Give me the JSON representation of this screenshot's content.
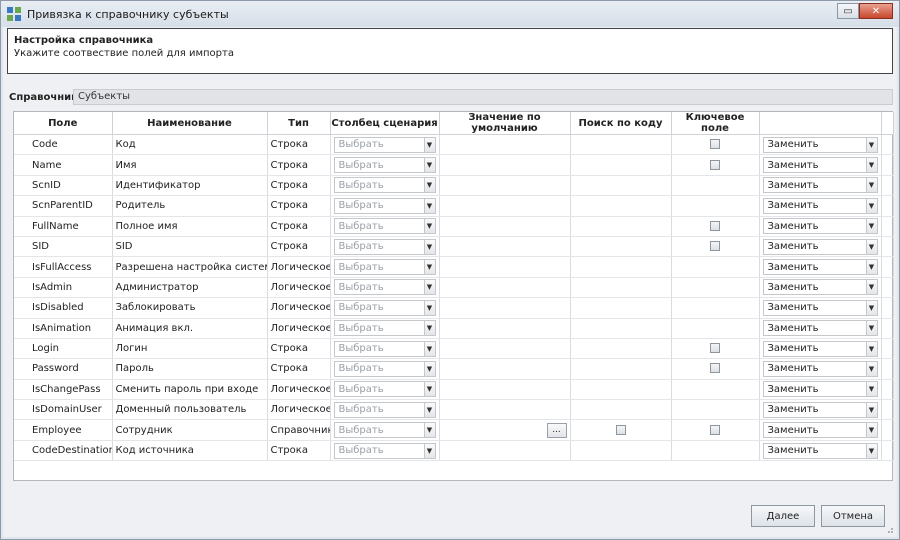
{
  "window": {
    "title": "Привязка к справочнику субъекты"
  },
  "header": {
    "title": "Настройка справочника",
    "subtitle": "Укажите соотвествие полей для импорта"
  },
  "reference": {
    "label": "Справочник",
    "value": "Субъекты"
  },
  "table": {
    "columns": [
      "Поле",
      "Наименование",
      "Тип",
      "Столбец сценария",
      "Значение по умолчанию",
      "Поиск по коду",
      "Ключевое поле",
      ""
    ],
    "rows": [
      {
        "field": "Code",
        "name": "Код",
        "type": "Строка",
        "scenario": "Выбрать",
        "default": "",
        "search_by_code": false,
        "key": true,
        "action": "Заменить"
      },
      {
        "field": "Name",
        "name": "Имя",
        "type": "Строка",
        "scenario": "Выбрать",
        "default": "",
        "search_by_code": false,
        "key": true,
        "action": "Заменить"
      },
      {
        "field": "ScnID",
        "name": "Идентификатор",
        "type": "Строка",
        "scenario": "Выбрать",
        "default": "",
        "search_by_code": false,
        "key": false,
        "action": "Заменить"
      },
      {
        "field": "ScnParentID",
        "name": "Родитель",
        "type": "Строка",
        "scenario": "Выбрать",
        "default": "",
        "search_by_code": false,
        "key": false,
        "action": "Заменить"
      },
      {
        "field": "FullName",
        "name": "Полное имя",
        "type": "Строка",
        "scenario": "Выбрать",
        "default": "",
        "search_by_code": false,
        "key": true,
        "action": "Заменить"
      },
      {
        "field": "SID",
        "name": "SID",
        "type": "Строка",
        "scenario": "Выбрать",
        "default": "",
        "search_by_code": false,
        "key": true,
        "action": "Заменить"
      },
      {
        "field": "IsFullAccess",
        "name": "Разрешена настройка системы",
        "type": "Логическое",
        "scenario": "Выбрать",
        "default": "",
        "search_by_code": false,
        "key": false,
        "action": "Заменить"
      },
      {
        "field": "IsAdmin",
        "name": "Администратор",
        "type": "Логическое",
        "scenario": "Выбрать",
        "default": "",
        "search_by_code": false,
        "key": false,
        "action": "Заменить"
      },
      {
        "field": "IsDisabled",
        "name": "Заблокировать",
        "type": "Логическое",
        "scenario": "Выбрать",
        "default": "",
        "search_by_code": false,
        "key": false,
        "action": "Заменить"
      },
      {
        "field": "IsAnimation",
        "name": "Анимация вкл.",
        "type": "Логическое",
        "scenario": "Выбрать",
        "default": "",
        "search_by_code": false,
        "key": false,
        "action": "Заменить"
      },
      {
        "field": "Login",
        "name": "Логин",
        "type": "Строка",
        "scenario": "Выбрать",
        "default": "",
        "search_by_code": false,
        "key": true,
        "action": "Заменить"
      },
      {
        "field": "Password",
        "name": "Пароль",
        "type": "Строка",
        "scenario": "Выбрать",
        "default": "",
        "search_by_code": false,
        "key": true,
        "action": "Заменить"
      },
      {
        "field": "IsChangePass",
        "name": "Сменить пароль при входе",
        "type": "Логическое",
        "scenario": "Выбрать",
        "default": "",
        "search_by_code": false,
        "key": false,
        "action": "Заменить"
      },
      {
        "field": "IsDomainUser",
        "name": "Доменный пользователь",
        "type": "Логическое",
        "scenario": "Выбрать",
        "default": "",
        "search_by_code": false,
        "key": false,
        "action": "Заменить"
      },
      {
        "field": "Employee",
        "name": "Сотрудник",
        "type": "Справочник",
        "scenario": "Выбрать",
        "default": "",
        "ellipsis": "...",
        "search_by_code": true,
        "key": true,
        "action": "Заменить"
      },
      {
        "field": "CodeDestination",
        "name": "Код источника",
        "type": "Строка",
        "scenario": "Выбрать",
        "default": "",
        "search_by_code": false,
        "key": false,
        "action": "Заменить"
      }
    ]
  },
  "buttons": {
    "ok": "Далее",
    "cancel": "Отмена"
  },
  "icons": {
    "app": "app-logo-icon",
    "restore": "restore-icon",
    "close": "close-icon",
    "dropdown": "dropdown-arrow-icon",
    "checkbox": "checkbox-icon",
    "grip": "resize-grip-icon"
  },
  "colors": {
    "accent": "#3a78c2",
    "close_button": "#c7482f",
    "window_bg": "#eef0f3"
  }
}
